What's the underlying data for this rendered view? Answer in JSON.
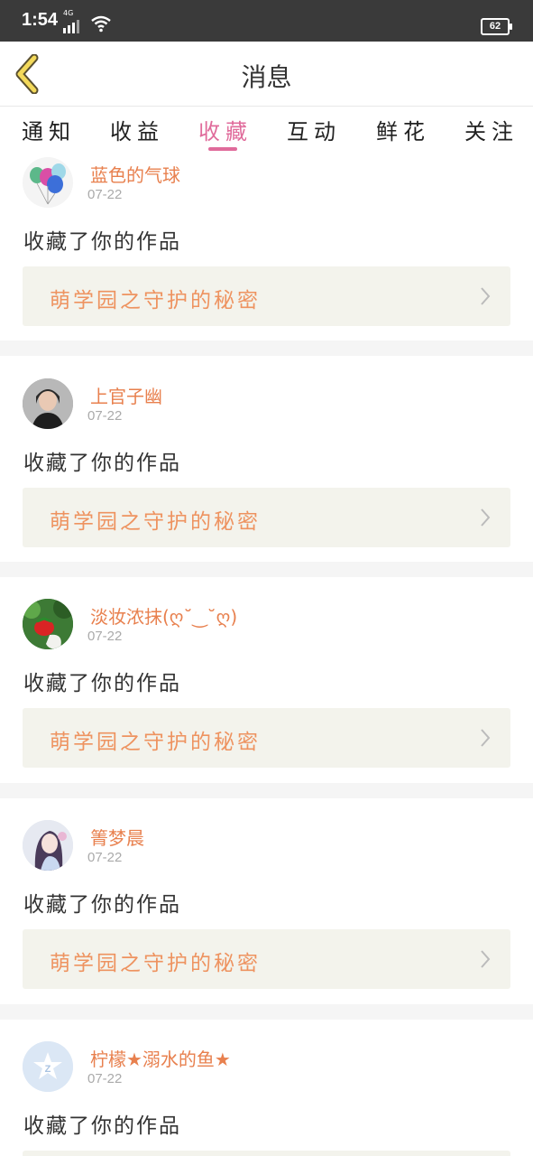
{
  "status_bar": {
    "time": "1:54",
    "network": "4G",
    "battery": "62"
  },
  "header": {
    "title": "消息"
  },
  "tabs": [
    {
      "label": "通知",
      "active": false
    },
    {
      "label": "收益",
      "active": false
    },
    {
      "label": "收藏",
      "active": true
    },
    {
      "label": "互动",
      "active": false
    },
    {
      "label": "鲜花",
      "active": false
    },
    {
      "label": "关注",
      "active": false
    }
  ],
  "items": [
    {
      "username": "蓝色的气球",
      "date": "07-22",
      "action": "收藏了你的作品",
      "work_title": "萌学园之守护的秘密",
      "avatar": "balloons"
    },
    {
      "username": "上官子幽",
      "date": "07-22",
      "action": "收藏了你的作品",
      "work_title": "萌学园之守护的秘密",
      "avatar": "photo-girl"
    },
    {
      "username": "淡妆浓抹(ღ˘‿˘ღ)",
      "date": "07-22",
      "action": "收藏了你的作品",
      "work_title": "萌学园之守护的秘密",
      "avatar": "green-strawberry"
    },
    {
      "username": "箐梦晨",
      "date": "07-22",
      "action": "收藏了你的作品",
      "work_title": "萌学园之守护的秘密",
      "avatar": "anime-girl"
    },
    {
      "username": "柠檬★溺水的鱼★",
      "date": "07-22",
      "action": "收藏了你的作品",
      "work_title": "",
      "avatar": "default-z"
    }
  ],
  "colors": {
    "accent": "#e06b9b",
    "username": "#e8804e",
    "work_title": "#ee9360",
    "work_bg": "#f3f3ec"
  }
}
